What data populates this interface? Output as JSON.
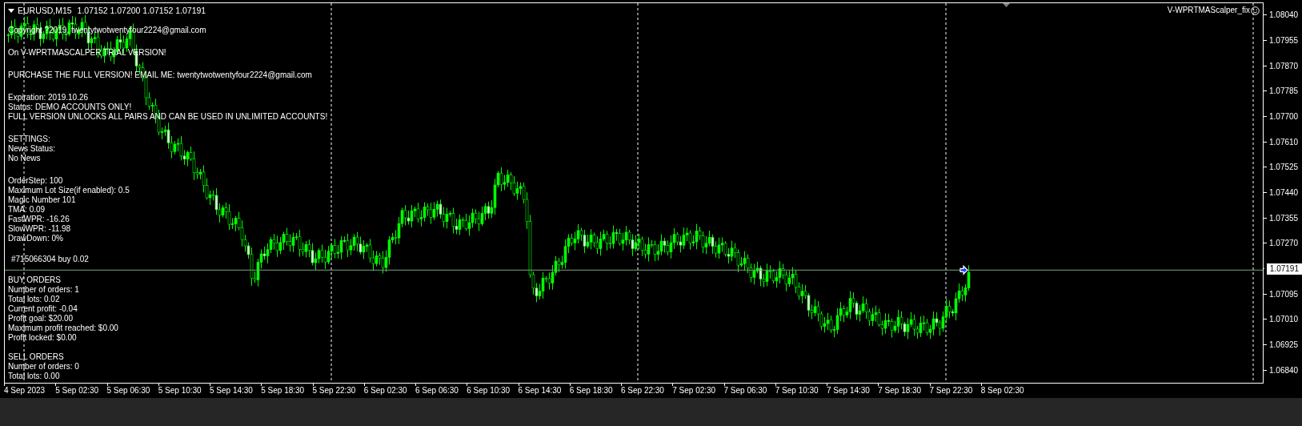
{
  "chart": {
    "symbol": "EURUSD,M15",
    "quotes": "1.07152 1.07200 1.07152 1.07191",
    "expert": "V-WPRTMAScalper_fix",
    "info_blocks": [
      [
        "Copyright ?2019, twentytwotwentyfour2224@gmail.com"
      ],
      [
        "On V-WPRTMASCALPER TRIAL VERSION!"
      ],
      [
        "PURCHASE THE FULL VERSION! EMAIL ME: twentytwotwentyfour2224@gmail.com"
      ],
      [
        "Expiration: 2019.10.26",
        "Status: DEMO ACCOUNTS ONLY!",
        "FULL VERSION UNLOCKS ALL PAIRS AND CAN BE USED IN UNLIMITED ACCOUNTS!"
      ],
      [
        "SETTINGS:",
        "News Status:",
        "No News"
      ],
      [
        "OrderStep: 100",
        "Maximum Lot Size(if enabled): 0.5",
        "Magic Number 101",
        "TMA: 0.09",
        "FastWPR: -16.26",
        "SlowWPR: -11.98",
        "DrawDown: 0%"
      ]
    ],
    "order_label": "#715066304 buy 0.02",
    "orders_blocks": [
      [
        "BUY ORDERS",
        "Number of orders: 1",
        "Total lots: 0.02",
        "Current profit: -0.04",
        "Profit goal: $20.00",
        "Maximum profit reached: $0.00",
        "Profit locked: $0.00"
      ],
      [
        "SELL ORDERS",
        "Number of orders: 0",
        "Total lots: 0.00"
      ]
    ]
  },
  "price_axis": [
    {
      "kind": "tick",
      "label": "1.08040"
    },
    {
      "kind": "tick",
      "label": "1.07955"
    },
    {
      "kind": "tick",
      "label": "1.07870"
    },
    {
      "kind": "tick",
      "label": "1.07785"
    },
    {
      "kind": "tick",
      "label": "1.07700"
    },
    {
      "kind": "tick",
      "label": "1.07610"
    },
    {
      "kind": "tick",
      "label": "1.07525"
    },
    {
      "kind": "tick",
      "label": "1.07440"
    },
    {
      "kind": "tick",
      "label": "1.07355"
    },
    {
      "kind": "tick",
      "label": "1.07270"
    },
    {
      "kind": "current",
      "label": "1.07191"
    },
    {
      "kind": "tick",
      "label": "1.07095"
    },
    {
      "kind": "tick",
      "label": "1.07010"
    },
    {
      "kind": "tick",
      "label": "1.06925"
    },
    {
      "kind": "tick",
      "label": "1.06840"
    }
  ],
  "time_axis": [
    "4 Sep 2023",
    "5 Sep 02:30",
    "5 Sep 06:30",
    "5 Sep 10:30",
    "5 Sep 14:30",
    "5 Sep 18:30",
    "5 Sep 22:30",
    "6 Sep 02:30",
    "6 Sep 06:30",
    "6 Sep 10:30",
    "6 Sep 14:30",
    "6 Sep 18:30",
    "6 Sep 22:30",
    "7 Sep 02:30",
    "7 Sep 06:30",
    "7 Sep 10:30",
    "7 Sep 14:30",
    "7 Sep 18:30",
    "7 Sep 22:30",
    "8 Sep 02:30"
  ]
}
